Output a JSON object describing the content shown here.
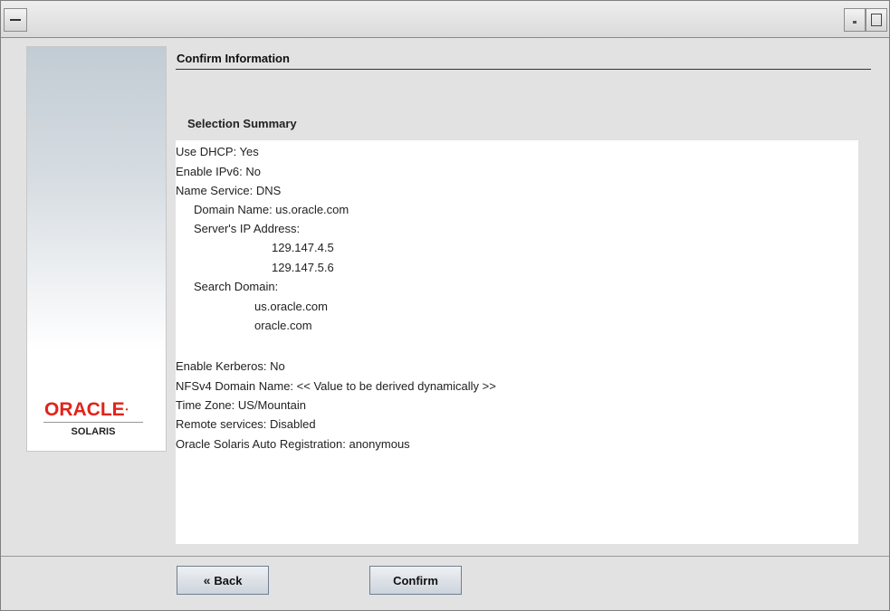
{
  "header": {
    "title": "Confirm Information",
    "section": "Selection Summary"
  },
  "logo": {
    "brand": "ORACLE",
    "product": "SOLARIS"
  },
  "summary": {
    "lines": [
      "Use DHCP: Yes",
      "Enable IPv6: No",
      "Name Service: DNS",
      "Domain Name: us.oracle.com",
      "Server's IP Address:",
      "129.147.4.5",
      "129.147.5.6",
      "Search Domain:",
      "us.oracle.com",
      "oracle.com",
      "Enable Kerberos: No",
      "NFSv4 Domain Name: << Value to be derived dynamically >>",
      "Time Zone: US/Mountain",
      "Remote services: Disabled",
      "Oracle Solaris Auto Registration: anonymous"
    ]
  },
  "buttons": {
    "back": "Back",
    "confirm": "Confirm"
  },
  "colors": {
    "brand_red": "#e2231a",
    "window_bg": "#e2e2e2"
  }
}
